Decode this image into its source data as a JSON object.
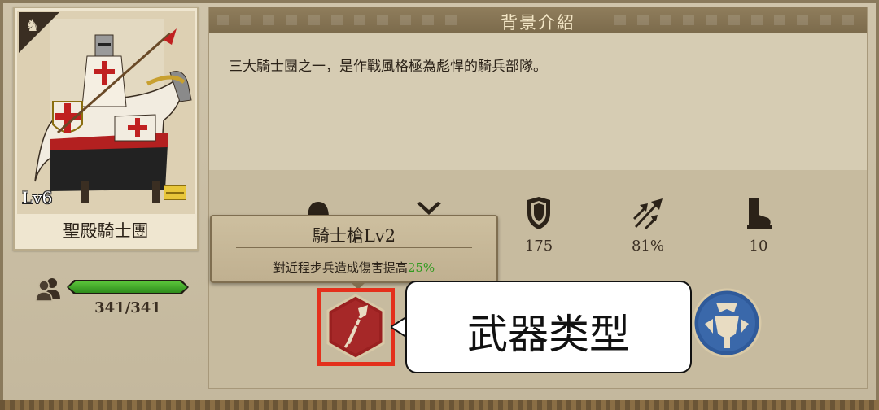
{
  "unit": {
    "name": "聖殿騎士團",
    "level": "Lv6",
    "hp": "341/341",
    "hp_fraction": 1.0
  },
  "panel": {
    "title": "背景介紹",
    "description": "三大騎士團之一，是作戰風格極為彪悍的騎兵部隊。"
  },
  "stats": [
    {
      "icon": "shield-icon",
      "value": "175"
    },
    {
      "icon": "arrows-icon",
      "value": "81%"
    },
    {
      "icon": "boot-icon",
      "value": "10"
    }
  ],
  "tooltip": {
    "title": "騎士槍Lv2",
    "desc_prefix": "對近程步兵造成傷害提高",
    "desc_highlight": "25%"
  },
  "callout": {
    "label": "武器类型"
  },
  "colors": {
    "hp_green": "#3aa626",
    "highlight_red": "#e4301c",
    "weapon_bg": "#9a2020",
    "armor_bg": "#2f5a9a"
  }
}
